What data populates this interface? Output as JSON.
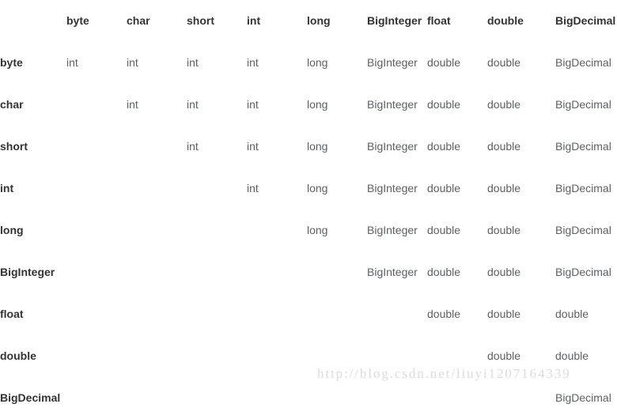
{
  "table": {
    "corner_label": "",
    "columns": [
      "byte",
      "char",
      "short",
      "int",
      "long",
      "BigInteger",
      "float",
      "double",
      "BigDecimal"
    ],
    "rows": [
      {
        "label": "byte",
        "cells": [
          "int",
          "int",
          "int",
          "int",
          "long",
          "BigInteger",
          "double",
          "double",
          "BigDecimal"
        ]
      },
      {
        "label": "char",
        "cells": [
          "",
          "int",
          "int",
          "int",
          "long",
          "BigInteger",
          "double",
          "double",
          "BigDecimal"
        ]
      },
      {
        "label": "short",
        "cells": [
          "",
          "",
          "int",
          "int",
          "long",
          "BigInteger",
          "double",
          "double",
          "BigDecimal"
        ]
      },
      {
        "label": "int",
        "cells": [
          "",
          "",
          "",
          "int",
          "long",
          "BigInteger",
          "double",
          "double",
          "BigDecimal"
        ]
      },
      {
        "label": "long",
        "cells": [
          "",
          "",
          "",
          "",
          "long",
          "BigInteger",
          "double",
          "double",
          "BigDecimal"
        ]
      },
      {
        "label": "BigInteger",
        "cells": [
          "",
          "",
          "",
          "",
          "",
          "BigInteger",
          "double",
          "double",
          "BigDecimal"
        ]
      },
      {
        "label": "float",
        "cells": [
          "",
          "",
          "",
          "",
          "",
          "",
          "double",
          "double",
          "double"
        ]
      },
      {
        "label": "double",
        "cells": [
          "",
          "",
          "",
          "",
          "",
          "",
          "",
          "double",
          "double"
        ]
      },
      {
        "label": "BigDecimal",
        "cells": [
          "",
          "",
          "",
          "",
          "",
          "",
          "",
          "",
          "BigDecimal"
        ]
      }
    ]
  },
  "watermark": {
    "text": "http://blog.csdn.net/liuyi1207164339"
  },
  "colors": {
    "background": "#ffffff",
    "header_text": "#333333",
    "cell_text": "#5d6063",
    "watermark_text": "#dcdcdc"
  }
}
